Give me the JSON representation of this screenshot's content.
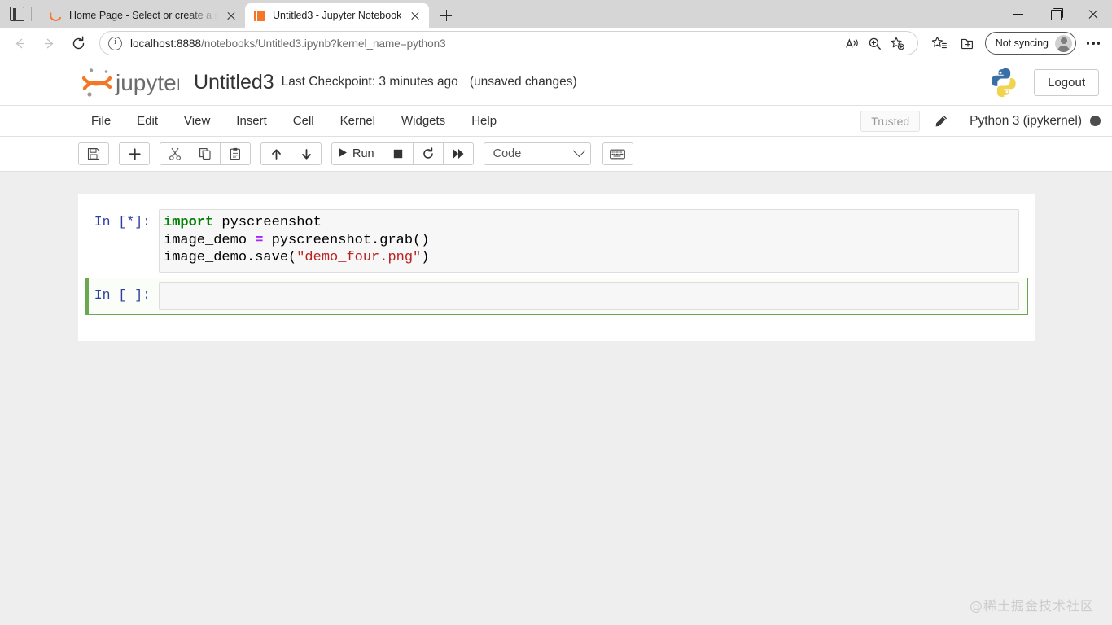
{
  "browser": {
    "tabs": [
      {
        "title": "Home Page - Select or create a n",
        "favicon": "jupyter-ring-icon",
        "active": false
      },
      {
        "title": "Untitled3 - Jupyter Notebook",
        "favicon": "jupyter-book-icon",
        "active": true
      }
    ],
    "new_tab_label": "+",
    "address": {
      "host": "localhost:8888",
      "path": "/notebooks/Untitled3.ipynb?kernel_name=python3",
      "full": "localhost:8888/notebooks/Untitled3.ipynb?kernel_name=python3"
    },
    "sync_label": "Not syncing",
    "icons": {
      "back": "back-arrow-icon",
      "forward": "forward-arrow-icon",
      "reload": "reload-icon",
      "site_info": "site-info-icon",
      "read_aloud": "read-aloud-icon",
      "zoom": "zoom-icon",
      "add_favorite": "add-favorite-icon",
      "favorites": "favorites-icon",
      "collections": "collections-icon",
      "settings": "settings-more-icon"
    },
    "window_controls": {
      "minimize": "minimize-icon",
      "maximize": "maximize-icon",
      "close": "close-icon"
    }
  },
  "jupyter": {
    "logo_text": "jupyter",
    "notebook_name": "Untitled3",
    "checkpoint": "Last Checkpoint: 3 minutes ago",
    "save_state": "(unsaved changes)",
    "logout_label": "Logout",
    "menu": [
      "File",
      "Edit",
      "View",
      "Insert",
      "Cell",
      "Kernel",
      "Widgets",
      "Help"
    ],
    "trusted_label": "Trusted",
    "kernel_name": "Python 3 (ipykernel)",
    "kernel_busy": true,
    "toolbar": {
      "groups": [
        [
          {
            "name": "save-button",
            "icon": "floppy-disk-icon",
            "label": ""
          }
        ],
        [
          {
            "name": "insert-cell-below-button",
            "icon": "plus-icon",
            "label": ""
          }
        ],
        [
          {
            "name": "cut-cell-button",
            "icon": "scissors-icon",
            "label": ""
          },
          {
            "name": "copy-cell-button",
            "icon": "copy-icon",
            "label": ""
          },
          {
            "name": "paste-cell-button",
            "icon": "paste-icon",
            "label": ""
          }
        ],
        [
          {
            "name": "move-cell-up-button",
            "icon": "arrow-up-icon",
            "label": ""
          },
          {
            "name": "move-cell-down-button",
            "icon": "arrow-down-icon",
            "label": ""
          }
        ],
        [
          {
            "name": "run-button",
            "icon": "play-icon",
            "label": "Run"
          },
          {
            "name": "interrupt-kernel-button",
            "icon": "stop-square-icon",
            "label": ""
          },
          {
            "name": "restart-kernel-button",
            "icon": "restart-circle-icon",
            "label": ""
          },
          {
            "name": "restart-and-run-all-button",
            "icon": "fast-forward-icon",
            "label": ""
          }
        ]
      ],
      "cell_type": "Code",
      "keyboard_shortcuts_icon": "keyboard-icon"
    }
  },
  "notebook": {
    "cells": [
      {
        "prompt": "In [*]:",
        "selected": false,
        "lines": [
          [
            {
              "t": "import",
              "c": "kw"
            },
            {
              "t": " pyscreenshot",
              "c": ""
            }
          ],
          [
            {
              "t": "image_demo ",
              "c": ""
            },
            {
              "t": "=",
              "c": "op"
            },
            {
              "t": " pyscreenshot.grab()",
              "c": ""
            }
          ],
          [
            {
              "t": "image_demo.save(",
              "c": ""
            },
            {
              "t": "\"demo_four.png\"",
              "c": "str"
            },
            {
              "t": ")",
              "c": ""
            }
          ]
        ]
      },
      {
        "prompt": "In [ ]:",
        "selected": true,
        "lines": [
          []
        ]
      }
    ]
  },
  "watermark": "@稀土掘金技术社区",
  "colors": {
    "jupyter_orange": "#f37726",
    "selected_cell_green": "#6aa84f",
    "keyword_green": "#008000",
    "string_red": "#ba2121",
    "operator_purple": "#aa22ff",
    "prompt_blue": "#303f9f",
    "page_background": "#eeeeee"
  }
}
